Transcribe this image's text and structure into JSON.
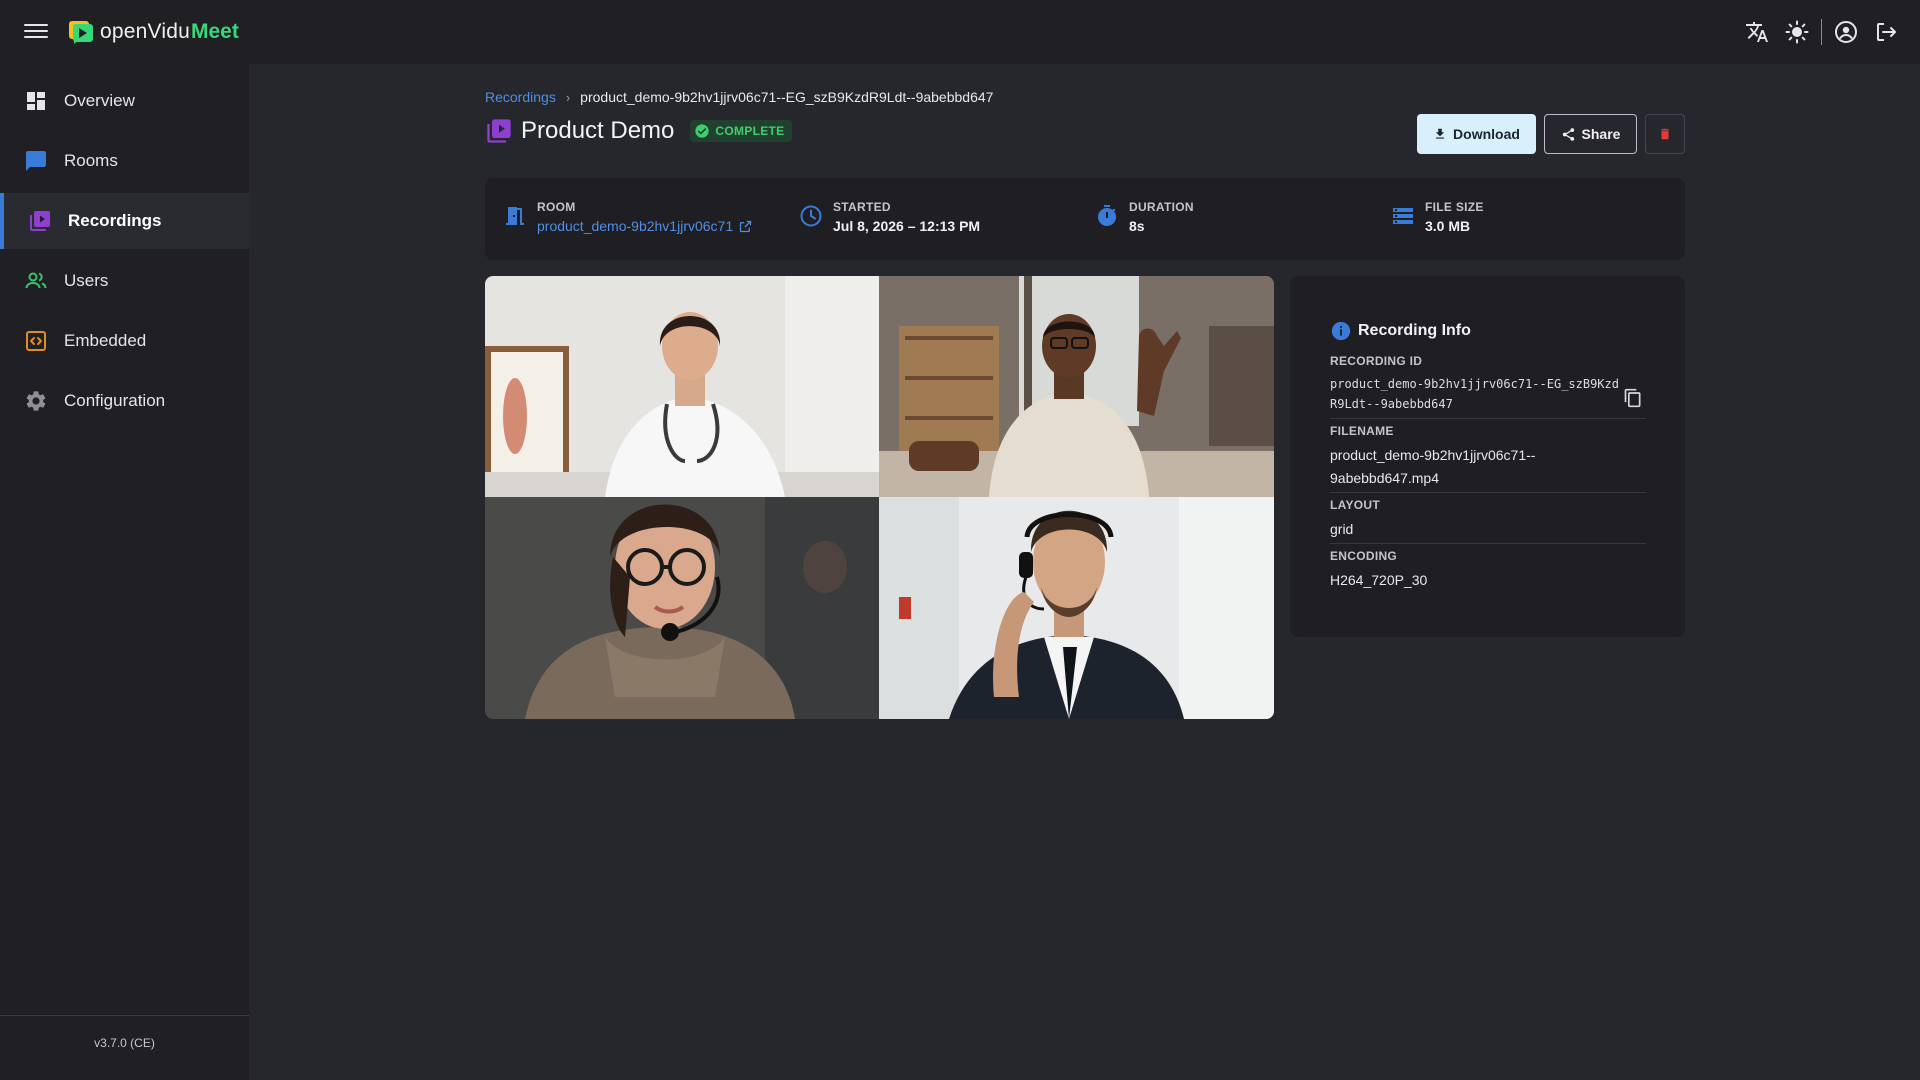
{
  "app": {
    "logo_text": "openVidu",
    "logo_accent": "Meet",
    "accent_color": "#39d67a"
  },
  "topbar": {
    "icons": [
      "translate-icon",
      "theme-light-icon",
      "account-icon",
      "logout-icon"
    ]
  },
  "sidebar": {
    "items": [
      {
        "label": "Overview",
        "icon": "dashboard-icon",
        "active": false
      },
      {
        "label": "Rooms",
        "icon": "chat-icon",
        "active": false
      },
      {
        "label": "Recordings",
        "icon": "video-library-icon",
        "active": true
      },
      {
        "label": "Users",
        "icon": "users-icon",
        "active": false
      },
      {
        "label": "Embedded",
        "icon": "code-icon",
        "active": false
      },
      {
        "label": "Configuration",
        "icon": "gear-icon",
        "active": false
      }
    ],
    "version": "v3.7.0 (CE)"
  },
  "breadcrumb": {
    "parent": "Recordings",
    "current": "product_demo-9b2hv1jjrv06c71--EG_szB9KzdR9Ldt--9abebbd647"
  },
  "header": {
    "title": "Product Demo",
    "status": "COMPLETE",
    "status_color": "#3fce6e",
    "download_label": "Download",
    "share_label": "Share"
  },
  "meta": {
    "room_label": "ROOM",
    "room_value": "product_demo-9b2hv1jjrv06c71",
    "started_label": "STARTED",
    "started_value": "Jul 8, 2026 – 12:13 PM",
    "duration_label": "DURATION",
    "duration_value": "8s",
    "filesize_label": "FILE SIZE",
    "filesize_value": "3.0 MB"
  },
  "info": {
    "title": "Recording Info",
    "recording_id_label": "RECORDING ID",
    "recording_id_value": "product_demo-9b2hv1jjrv06c71--EG_szB9KzdR9Ldt--9abebbd647",
    "filename_label": "FILENAME",
    "filename_value": "product_demo-9b2hv1jjrv06c71--9abebbd647.mp4",
    "layout_label": "LAYOUT",
    "layout_value": "grid",
    "encoding_label": "ENCODING",
    "encoding_value": "H264_720P_30"
  }
}
